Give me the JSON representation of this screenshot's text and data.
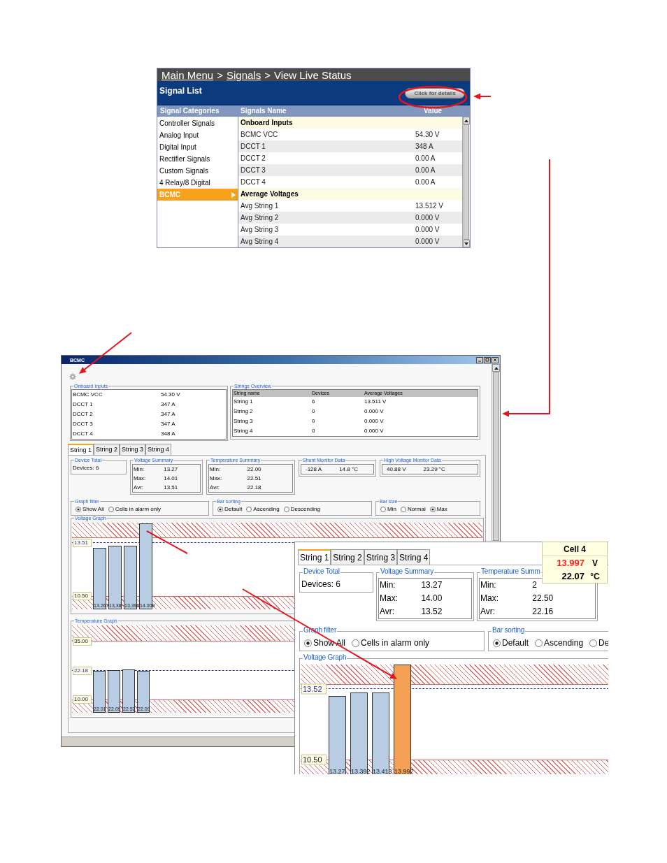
{
  "signal_list_screen": {
    "breadcrumb": [
      {
        "kind": "link",
        "label": "Main Menu"
      },
      {
        "kind": "separator",
        "label": ">"
      },
      {
        "kind": "link",
        "label": "Signals"
      },
      {
        "kind": "separator",
        "label": ">"
      },
      {
        "kind": "current",
        "label": "View Live Status"
      }
    ],
    "title": "Signal List",
    "details_button": "Click for details",
    "columns": [
      "Signal Categories",
      "Signals Name",
      "Value"
    ],
    "categories": [
      {
        "label": "Controller Signals",
        "selected": false
      },
      {
        "label": "Analog Input",
        "selected": false
      },
      {
        "label": "Digital Input",
        "selected": false
      },
      {
        "label": "Rectifier Signals",
        "selected": false
      },
      {
        "label": "Custom Signals",
        "selected": false
      },
      {
        "label": "4 Relay/8 Digital",
        "selected": false
      },
      {
        "label": "BCMC",
        "selected": true
      }
    ],
    "signals": [
      {
        "kind": "section",
        "name": "Onboard Inputs"
      },
      {
        "kind": "signal",
        "name": "BCMC VCC",
        "value": "54.30 V"
      },
      {
        "kind": "signal",
        "name": "DCCT 1",
        "value": "348 A"
      },
      {
        "kind": "signal",
        "name": "DCCT 2",
        "value": "0.00 A"
      },
      {
        "kind": "signal",
        "name": "DCCT 3",
        "value": "0.00 A"
      },
      {
        "kind": "signal",
        "name": "DCCT 4",
        "value": "0.00 A"
      },
      {
        "kind": "section",
        "name": "Average Voltages"
      },
      {
        "kind": "signal",
        "name": "Avg String 1",
        "value": "13.512 V"
      },
      {
        "kind": "signal",
        "name": "Avg String 2",
        "value": "0.000 V"
      },
      {
        "kind": "signal",
        "name": "Avg String 3",
        "value": "0.000 V"
      },
      {
        "kind": "signal",
        "name": "Avg String 4",
        "value": "0.000 V"
      }
    ]
  },
  "bcmc_window": {
    "title": "BCMC",
    "onboard_inputs": {
      "title": "Onboard Inputs",
      "rows": [
        {
          "name": "BCMC VCC",
          "value": "54.30 V"
        },
        {
          "name": "DCCT 1",
          "value": "347 A"
        },
        {
          "name": "DCCT 2",
          "value": "347 A"
        },
        {
          "name": "DCCT 3",
          "value": "347 A"
        },
        {
          "name": "DCCT 4",
          "value": "348 A"
        }
      ]
    },
    "strings_overview": {
      "title": "Strings Overview",
      "columns": [
        "String name",
        "Devices",
        "Average Voltages"
      ],
      "rows": [
        [
          "String 1",
          "6",
          "13.511 V"
        ],
        [
          "String 2",
          "0",
          "0.000 V"
        ],
        [
          "String 3",
          "0",
          "0.000 V"
        ],
        [
          "String 4",
          "0",
          "0.000 V"
        ]
      ]
    },
    "string_panel": {
      "tabs": [
        {
          "label": "String 1",
          "selected": true
        },
        {
          "label": "String 2",
          "selected": false
        },
        {
          "label": "String 3",
          "selected": false
        },
        {
          "label": "String 4",
          "selected": false
        }
      ],
      "sections": [
        {
          "groups": [
            {
              "kind": "text",
              "title": "Device Total",
              "text": "Devices: 6"
            },
            {
              "kind": "stats",
              "title": "Voltage Summary",
              "rows": [
                {
                  "label": "Min:",
                  "value": "13.27"
                },
                {
                  "label": "Max:",
                  "value": "14.01"
                },
                {
                  "label": "Avr:",
                  "value": "13.51"
                }
              ]
            },
            {
              "kind": "stats",
              "title": "Temperature Summary",
              "rows": [
                {
                  "label": "Min:",
                  "value": "22.00"
                },
                {
                  "label": "Max:",
                  "value": "22.51"
                },
                {
                  "label": "Avr:",
                  "value": "22.18"
                }
              ]
            },
            {
              "kind": "readings",
              "title": "Shunt Monitor Data",
              "values": [
                "-128 A",
                "14.8 °C"
              ]
            },
            {
              "kind": "readings",
              "title": "High Voltage Monitor Data",
              "values": [
                "40.88 V",
                "23.29 °C"
              ]
            }
          ]
        },
        {
          "groups": [
            {
              "kind": "radios",
              "title": "Graph filter",
              "options": [
                {
                  "label": "Show All",
                  "selected": true
                },
                {
                  "label": "Cells in alarm only",
                  "selected": false
                }
              ]
            },
            {
              "kind": "radios",
              "title": "Bar sorting",
              "options": [
                {
                  "label": "Default",
                  "selected": true
                },
                {
                  "label": "Ascending",
                  "selected": false
                },
                {
                  "label": "Descending",
                  "selected": false
                }
              ]
            },
            {
              "kind": "radios",
              "title": "Bar size",
              "options": [
                {
                  "label": "Min",
                  "selected": false
                },
                {
                  "label": "Normal",
                  "selected": false
                },
                {
                  "label": "Max",
                  "selected": true
                }
              ]
            }
          ]
        },
        {
          "groups": [
            {
              "kind": "graph",
              "title": "Voltage Graph",
              "low_label": "10.50",
              "average": {
                "label": "13.51"
              },
              "bars": [
                {
                  "label": "13.267",
                  "alarm": false
                },
                {
                  "label": "13.38",
                  "alarm": false
                },
                {
                  "label": "13.392",
                  "alarm": false
                },
                {
                  "label": "14.008",
                  "alarm": false
                }
              ]
            }
          ]
        },
        {
          "groups": [
            {
              "kind": "graph",
              "title": "Temperature Graph",
              "high_label": "35.00",
              "low_label": "10.00",
              "average": {
                "label": "22.18"
              },
              "bars": [
                {
                  "label": "22.01",
                  "alarm": false
                },
                {
                  "label": "22.09",
                  "alarm": false
                },
                {
                  "label": "22.52",
                  "alarm": false
                },
                {
                  "label": "22.09",
                  "alarm": false
                }
              ]
            }
          ]
        }
      ]
    }
  },
  "zoomed_panel": {
    "tabs": [
      {
        "label": "String 1",
        "selected": true
      },
      {
        "label": "String 2",
        "selected": false
      },
      {
        "label": "String 3",
        "selected": false
      },
      {
        "label": "String 4",
        "selected": false
      }
    ],
    "sections": [
      {
        "groups": [
          {
            "kind": "text",
            "title": "Device Total",
            "text": "Devices: 6"
          },
          {
            "kind": "stats",
            "title": "Voltage Summary",
            "rows": [
              {
                "label": "Min:",
                "value": "13.27"
              },
              {
                "label": "Max:",
                "value": "14.00"
              },
              {
                "label": "Avr:",
                "value": "13.52"
              }
            ]
          },
          {
            "kind": "stats",
            "title": "Temperature Summ",
            "rows": [
              {
                "label": "Min:",
                "value": "2"
              },
              {
                "label": "Max:",
                "value": "22.50"
              },
              {
                "label": "Avr:",
                "value": "22.16"
              }
            ]
          }
        ]
      },
      {
        "groups": [
          {
            "kind": "radios",
            "title": "Graph filter",
            "options": [
              {
                "label": "Show All",
                "selected": true
              },
              {
                "label": "Cells in alarm only",
                "selected": false
              }
            ]
          },
          {
            "kind": "radios",
            "title": "Bar sorting",
            "options": [
              {
                "label": "Default",
                "selected": true
              },
              {
                "label": "Ascending",
                "selected": false
              },
              {
                "label": "De",
                "selected": false
              }
            ]
          }
        ]
      },
      {
        "groups": [
          {
            "kind": "graph",
            "title": "Voltage Graph",
            "low_label": "10.50",
            "average": {
              "label": "13.52"
            },
            "bars": [
              {
                "label": "13.27",
                "alarm": false
              },
              {
                "label": "13.392",
                "alarm": false
              },
              {
                "label": "13.413",
                "alarm": false
              },
              {
                "label": "13.997",
                "alarm": true
              }
            ]
          }
        ]
      }
    ]
  },
  "tooltip": {
    "title": "Cell 4",
    "rows": [
      {
        "value": "13.997",
        "unit": "V",
        "alarm": true
      },
      {
        "value": "22.07",
        "unit": "°C",
        "alarm": false
      }
    ]
  }
}
